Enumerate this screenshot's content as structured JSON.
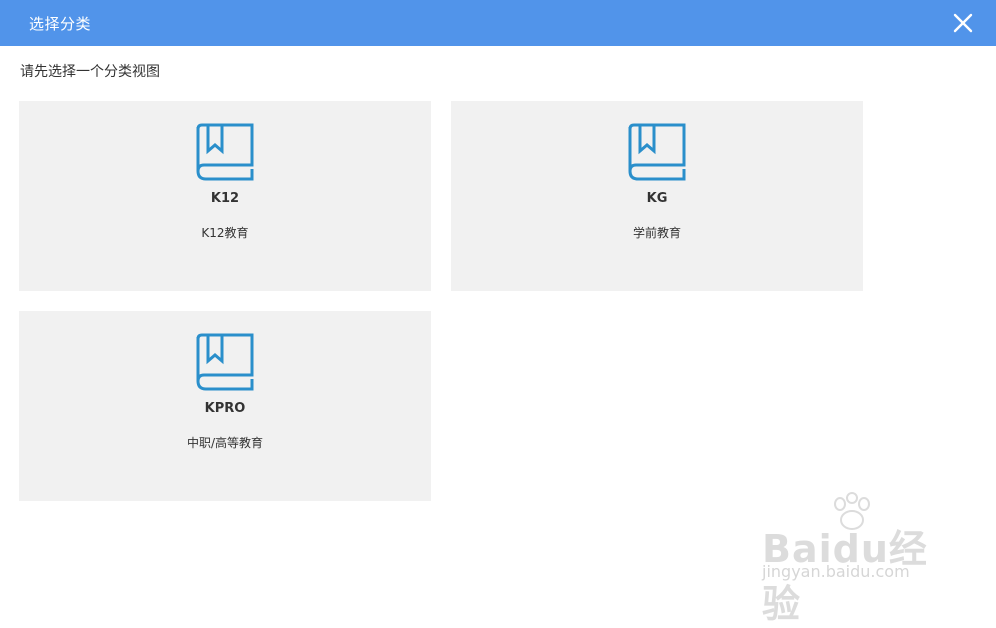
{
  "dialog": {
    "title": "选择分类",
    "prompt": "请先选择一个分类视图"
  },
  "cards": [
    {
      "code": "K12",
      "desc": "K12教育",
      "icon": "book-icon"
    },
    {
      "code": "KG",
      "desc": "学前教育",
      "icon": "book-icon"
    },
    {
      "code": "KPRO",
      "desc": "中职/高等教育",
      "icon": "book-icon"
    }
  ],
  "watermark": {
    "logo": "Baidu经验",
    "url": "jingyan.baidu.com"
  },
  "colors": {
    "header": "#5194ea",
    "card_bg": "#f1f1f1",
    "icon": "#2a8fcb"
  }
}
